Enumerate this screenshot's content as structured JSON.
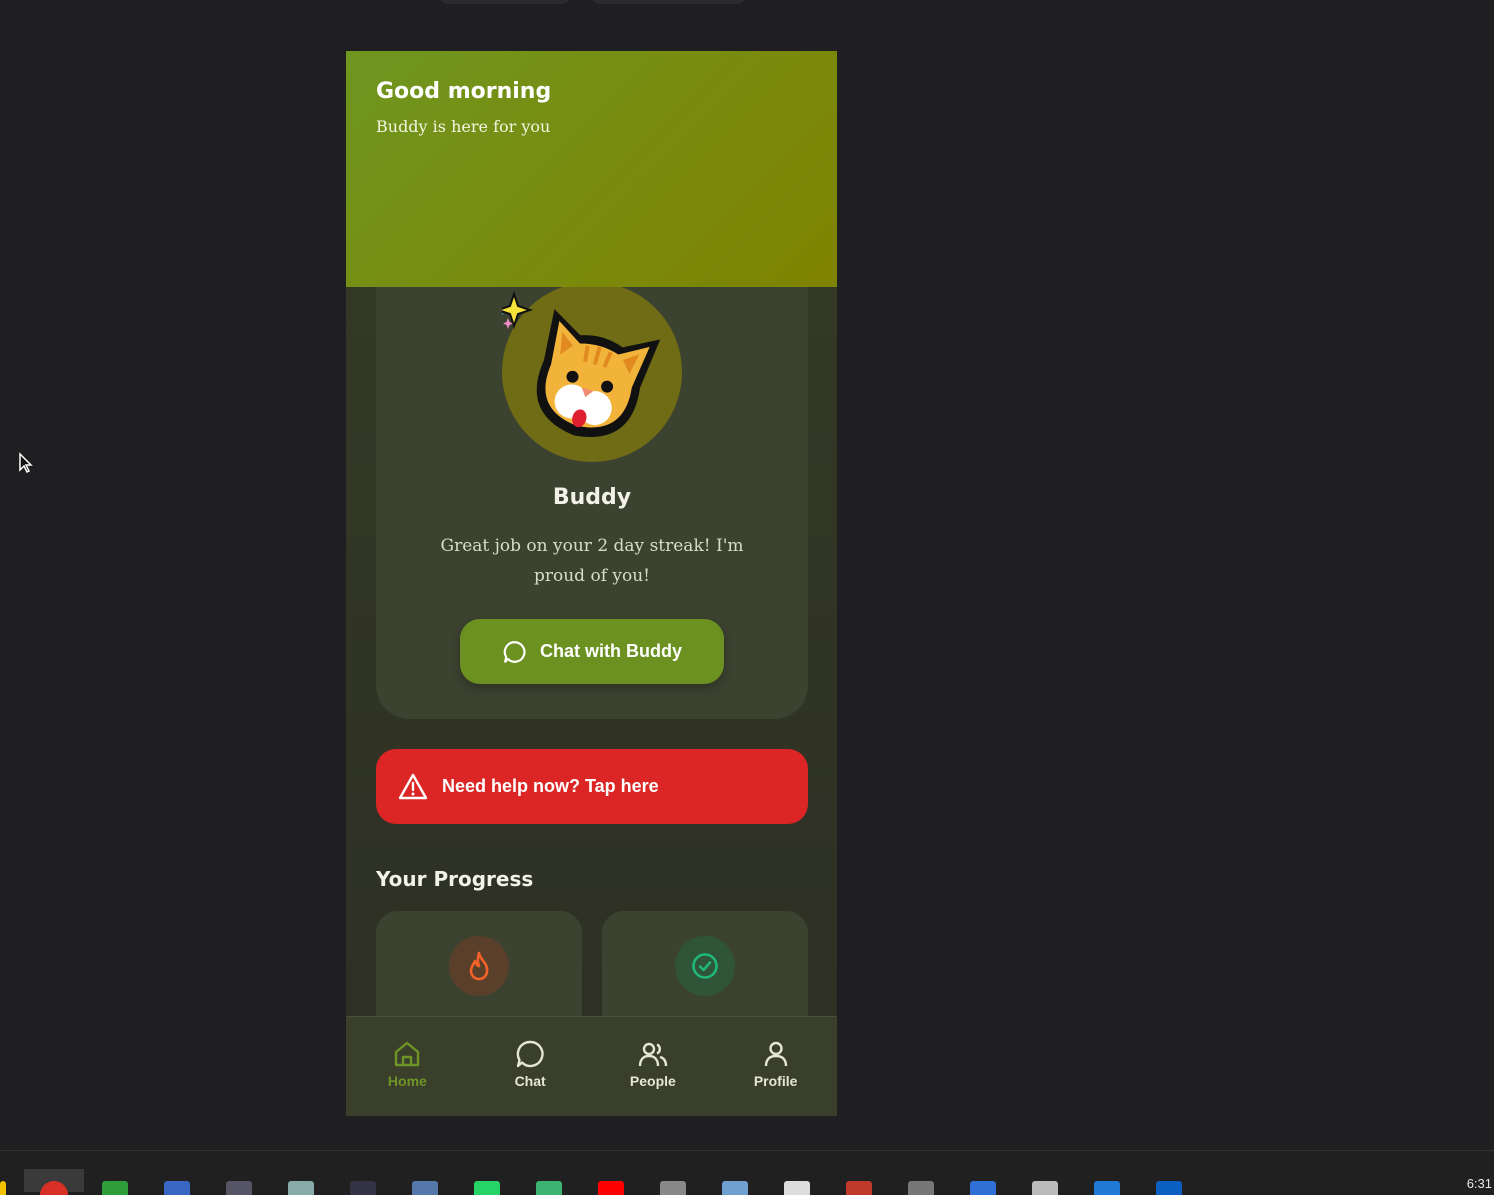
{
  "header": {
    "greeting": "Good morning",
    "subtitle": "Buddy is here for you"
  },
  "buddy": {
    "name": "Buddy",
    "message": "Great job on your 2 day streak! I'm proud of you!",
    "chat_button": "Chat with Buddy"
  },
  "help": {
    "label": "Need help now? Tap here"
  },
  "progress": {
    "title": "Your Progress",
    "cards": [
      {
        "icon": "flame-icon",
        "color": "#f4622a"
      },
      {
        "icon": "check-circle-icon",
        "color": "#1fb877"
      }
    ]
  },
  "nav": {
    "items": [
      {
        "label": "Home",
        "icon": "home-icon",
        "active": true
      },
      {
        "label": "Chat",
        "icon": "chat-icon"
      },
      {
        "label": "People",
        "icon": "people-icon"
      },
      {
        "label": "Profile",
        "icon": "profile-icon"
      }
    ]
  },
  "taskbar": {
    "clock": "6:31"
  },
  "colors": {
    "accent": "#6c9120",
    "danger": "#dc2626",
    "background": "#1f1f21"
  }
}
